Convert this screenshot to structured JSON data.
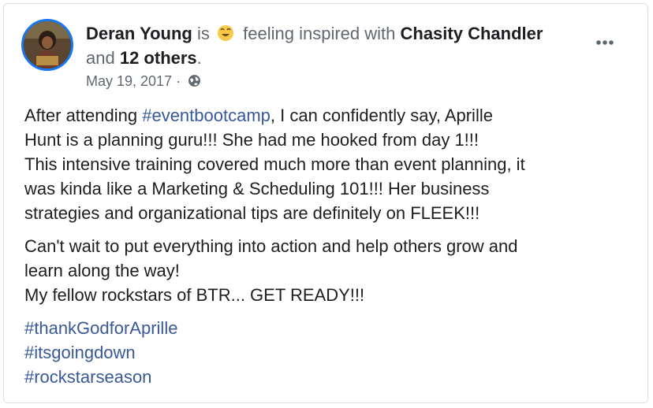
{
  "post": {
    "author": "Deran Young",
    "is_text": "is",
    "feeling_text": "feeling inspired with",
    "tagged_person": "Chasity Chandler",
    "and_text": "and",
    "others": "12 others",
    "period": ".",
    "date": "May 19, 2017",
    "dot": "·",
    "privacy_icon": "globe-icon",
    "feeling_icon": "smiley-face-icon",
    "more_icon": "ellipsis-icon",
    "paragraph1": {
      "line1_pre": "After attending ",
      "line1_tag": "#eventbootcamp",
      "line1_post": ", I can confidently say, Aprille",
      "line2": "Hunt is a planning guru!!! She had me hooked from day 1!!!",
      "line3": "This intensive training covered much more than event planning, it",
      "line4": "was kinda like a Marketing & Scheduling 101!!! Her business",
      "line5": "strategies and organizational tips are definitely on FLEEK!!!"
    },
    "paragraph2": {
      "line1": "Can't wait to put everything into action and help others grow and",
      "line2": "learn along the way!",
      "line3": "My fellow rockstars of BTR... GET READY!!!"
    },
    "hashtags": [
      "#thankGodforAprille",
      "#itsgoingdown",
      "#rockstarseason"
    ]
  },
  "colors": {
    "link": "#385898",
    "avatar_ring": "#1877f2",
    "muted": "#606770",
    "text": "#1c1e21"
  }
}
